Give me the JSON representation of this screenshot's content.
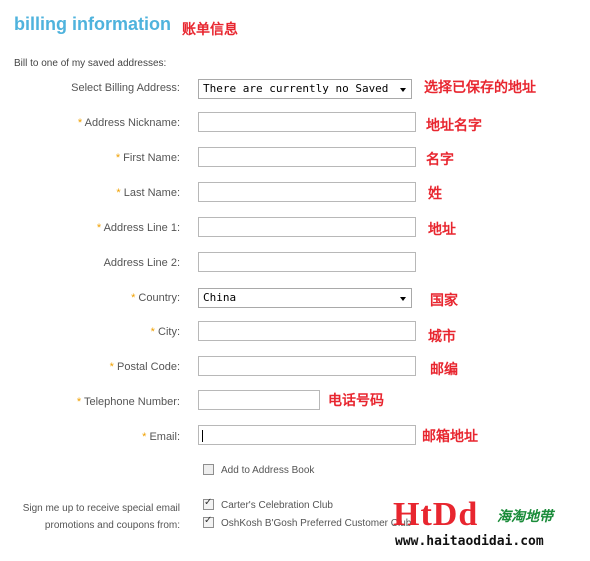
{
  "header": {
    "title": "billing information",
    "annotation": "账单信息"
  },
  "intro": "Bill to one of my saved addresses:",
  "saved_address": {
    "label": "Select Billing Address:",
    "value": "There are currently no Saved",
    "annotation": "选择已保存的地址"
  },
  "fields": {
    "nickname": {
      "label": "Address Nickname:",
      "value": "",
      "annotation": "地址名字"
    },
    "first_name": {
      "label": "First Name:",
      "value": "",
      "annotation": "名字"
    },
    "last_name": {
      "label": "Last Name:",
      "value": "",
      "annotation": "姓"
    },
    "address1": {
      "label": "Address Line 1:",
      "value": "",
      "annotation": "地址"
    },
    "address2": {
      "label": "Address Line 2:",
      "value": ""
    },
    "country": {
      "label": "Country:",
      "value": "China",
      "annotation": "国家"
    },
    "city": {
      "label": "City:",
      "value": "",
      "annotation": "城市"
    },
    "postal": {
      "label": "Postal Code:",
      "value": "",
      "annotation": "邮编"
    },
    "phone": {
      "label": "Telephone Number:",
      "value": "",
      "annotation": "电话号码"
    },
    "email": {
      "label": "Email:",
      "value": "",
      "annotation": "邮箱地址"
    }
  },
  "required_mark": "*",
  "address_book": {
    "label": "Add to Address Book",
    "checked": false
  },
  "signup": {
    "label_line1": "Sign me up to receive special email",
    "label_line2": "promotions and coupons from:",
    "options": [
      {
        "label": "Carter's Celebration Club",
        "checked": true
      },
      {
        "label": "OshKosh B'Gosh Preferred Customer Club",
        "checked": true
      }
    ]
  },
  "watermark": {
    "logo": "HtDd",
    "cn": "海淘地带",
    "url": "www.haitaodidai.com"
  },
  "colors": {
    "title": "#4fb3dd",
    "annotation": "#e8262f",
    "required": "#f0a000"
  }
}
